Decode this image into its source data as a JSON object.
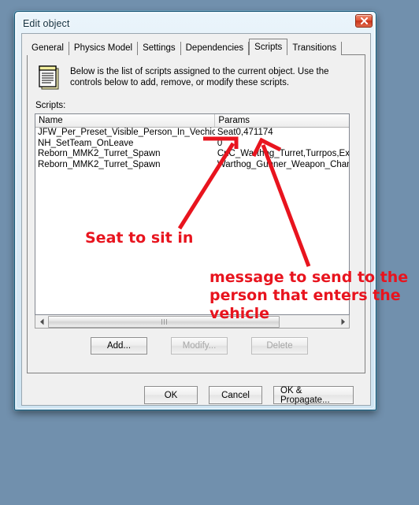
{
  "desktop": {
    "background_color": "#7190ad"
  },
  "window": {
    "title": "Edit object",
    "close_icon": "close-icon",
    "accent_color": "#1d5a78"
  },
  "tabs": [
    {
      "label": "General",
      "active": false
    },
    {
      "label": "Physics Model",
      "active": false
    },
    {
      "label": "Settings",
      "active": false
    },
    {
      "label": "Dependencies",
      "active": false
    },
    {
      "label": "Scripts",
      "active": true
    },
    {
      "label": "Transitions",
      "active": false
    }
  ],
  "description": {
    "icon": "note-document-icon",
    "text": "Below is the list of scripts assigned to the current object.  Use the controls below to add, remove, or modify these scripts."
  },
  "list": {
    "label": "Scripts:",
    "columns": [
      "Name",
      "Params"
    ],
    "rows": [
      {
        "name": "JFW_Per_Preset_Visible_Person_In_Vechicle",
        "params": "Seat0,471174"
      },
      {
        "name": "NH_SetTeam_OnLeave",
        "params": "0"
      },
      {
        "name": "Reborn_MMK2_Turret_Spawn",
        "params": "CnC_Warthog_Turret,Turrpos,Exp"
      },
      {
        "name": "Reborn_MMK2_Turret_Spawn",
        "params": "Warthog_Gunner_Weapon_Chan"
      }
    ],
    "scrollbar": {
      "left_arrow": "scroll-left-icon",
      "right_arrow": "scroll-right-icon"
    }
  },
  "actions": [
    {
      "label": "Add...",
      "enabled": true
    },
    {
      "label": "Modify...",
      "enabled": false
    },
    {
      "label": "Delete",
      "enabled": false
    }
  ],
  "dialog_buttons": [
    {
      "label": "OK"
    },
    {
      "label": "Cancel"
    },
    {
      "label": "OK & Propagate..."
    }
  ],
  "annotations": {
    "color": "#e8141e",
    "seat_note": "Seat to sit in",
    "message_note": "message to send to the person that enters the vehicle"
  }
}
